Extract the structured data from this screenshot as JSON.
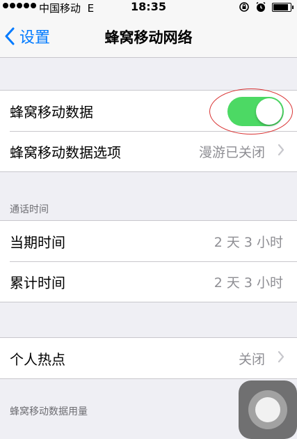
{
  "status_bar": {
    "carrier": "中国移动",
    "network": "E",
    "time": "18:35"
  },
  "nav": {
    "back_label": "设置",
    "title": "蜂窝移动网络"
  },
  "cellular": {
    "data_label": "蜂窝移动数据",
    "data_enabled": true,
    "options_label": "蜂窝移动数据选项",
    "options_value": "漫游已关闭"
  },
  "call_time": {
    "header": "通话时间",
    "rows": [
      {
        "label": "当期时间",
        "value": "2 天 3 小时"
      },
      {
        "label": "累计时间",
        "value": "2 天 3 小时"
      }
    ]
  },
  "hotspot": {
    "label": "个人热点",
    "value": "关闭"
  },
  "usage": {
    "header": "蜂窝移动数据用量"
  },
  "colors": {
    "accent": "#007aff",
    "toggle_on": "#4cd964",
    "annotation": "#d93333",
    "background": "#efeff4"
  }
}
